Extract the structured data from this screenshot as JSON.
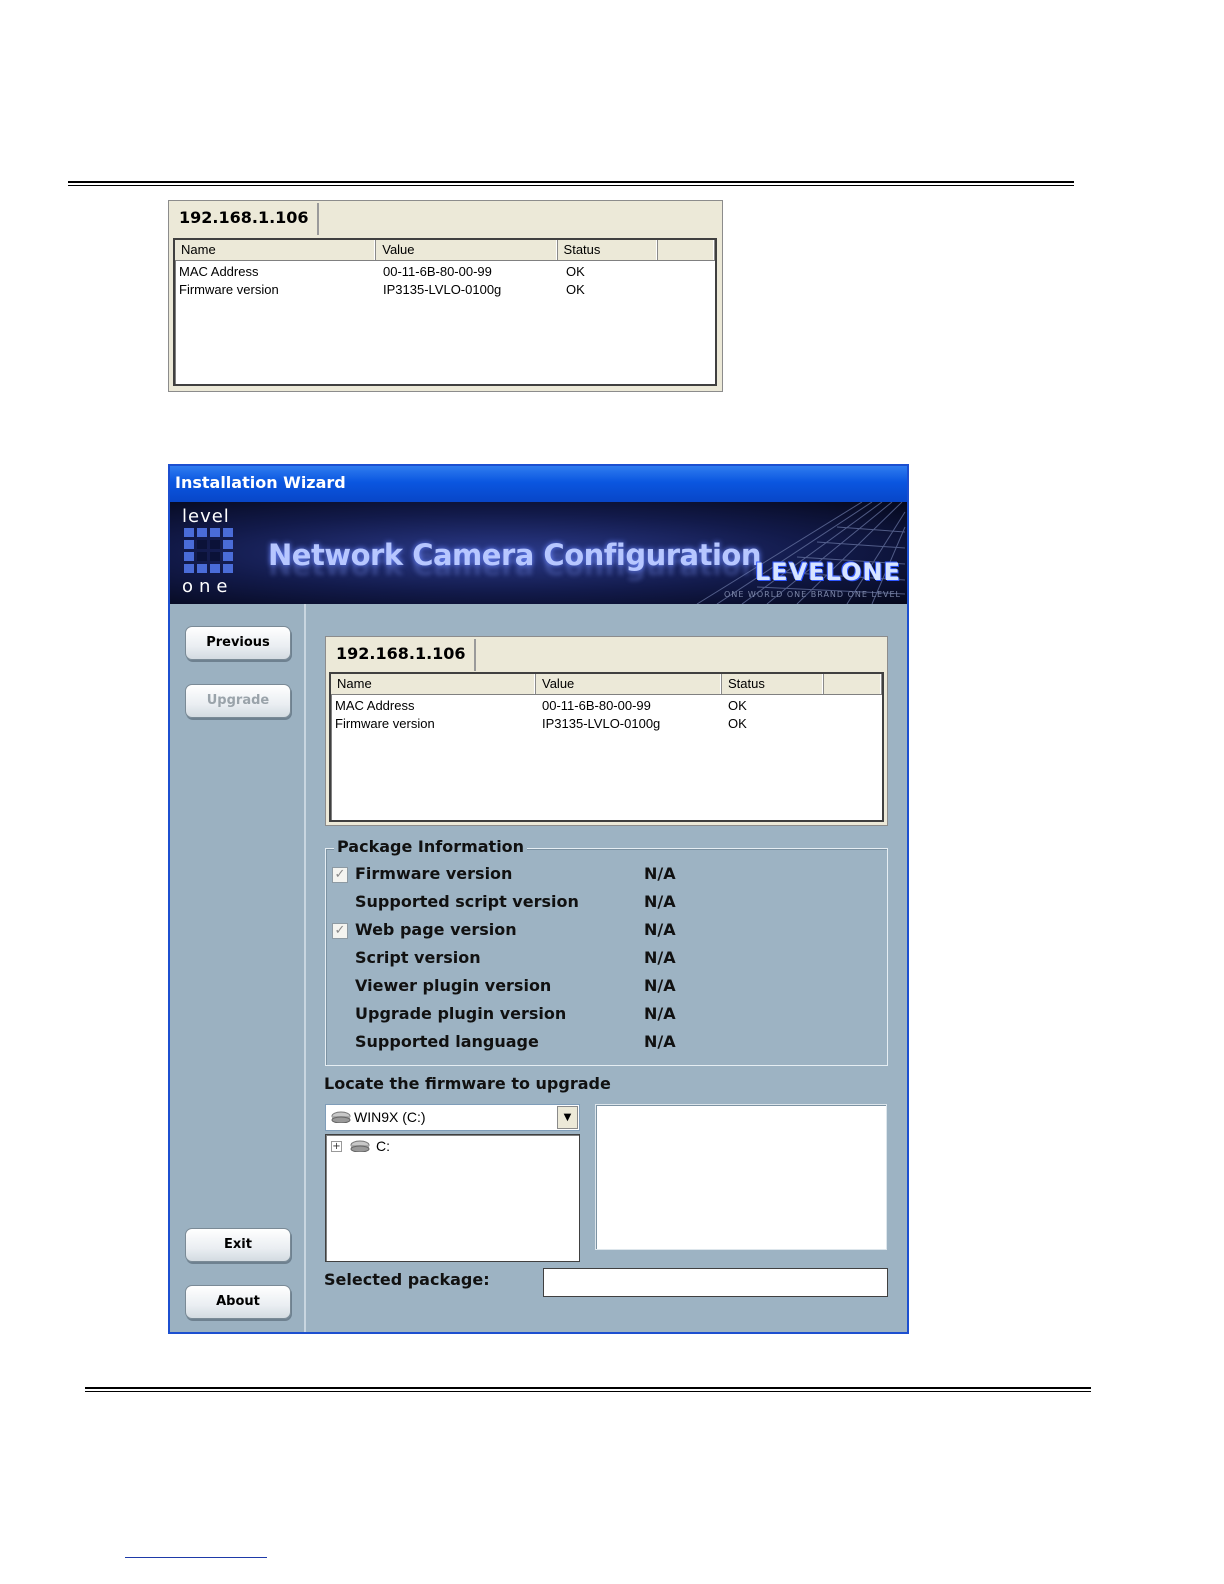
{
  "device_panel": {
    "tab_label": "192.168.1.106",
    "columns": [
      "Name",
      "Value",
      "Status",
      ""
    ],
    "rows": [
      {
        "name": "MAC Address",
        "value": "00-11-6B-80-00-99",
        "status": "OK"
      },
      {
        "name": "Firmware version",
        "value": "IP3135-LVLO-0100g",
        "status": "OK"
      }
    ]
  },
  "wizard": {
    "title": "Installation Wizard",
    "banner": {
      "logo_top": "level",
      "logo_bottom": "one",
      "title": "Network Camera Configuration",
      "brand": "LEVELONE",
      "slogan": "ONE WORLD  ONE BRAND  ONE LEVEL"
    },
    "sidebar": {
      "previous": "Previous",
      "upgrade": "Upgrade",
      "exit": "Exit",
      "about": "About"
    },
    "package_info": {
      "legend": "Package Information",
      "rows": [
        {
          "label": "Firmware version",
          "value": "N/A",
          "checkbox": true,
          "checked": true
        },
        {
          "label": "Supported script version",
          "value": "N/A",
          "checkbox": false
        },
        {
          "label": "Web page version",
          "value": "N/A",
          "checkbox": true,
          "checked": true
        },
        {
          "label": "Script version",
          "value": "N/A",
          "checkbox": false
        },
        {
          "label": "Viewer plugin version",
          "value": "N/A",
          "checkbox": false
        },
        {
          "label": "Upgrade plugin version",
          "value": "N/A",
          "checkbox": false
        },
        {
          "label": "Supported language",
          "value": "N/A",
          "checkbox": false
        }
      ]
    },
    "locate_label": "Locate the firmware to upgrade",
    "drive_select": {
      "value": "WIN9X (C:)",
      "icon": "hard-drive-icon"
    },
    "tree": {
      "node": "C:",
      "icon": "hard-drive-icon"
    },
    "selected_package_label": "Selected package:",
    "selected_package_value": ""
  },
  "colors": {
    "titlebar": "#0a56e0",
    "window_bg": "#9db3c3",
    "panel_bg": "#ece9d8"
  }
}
